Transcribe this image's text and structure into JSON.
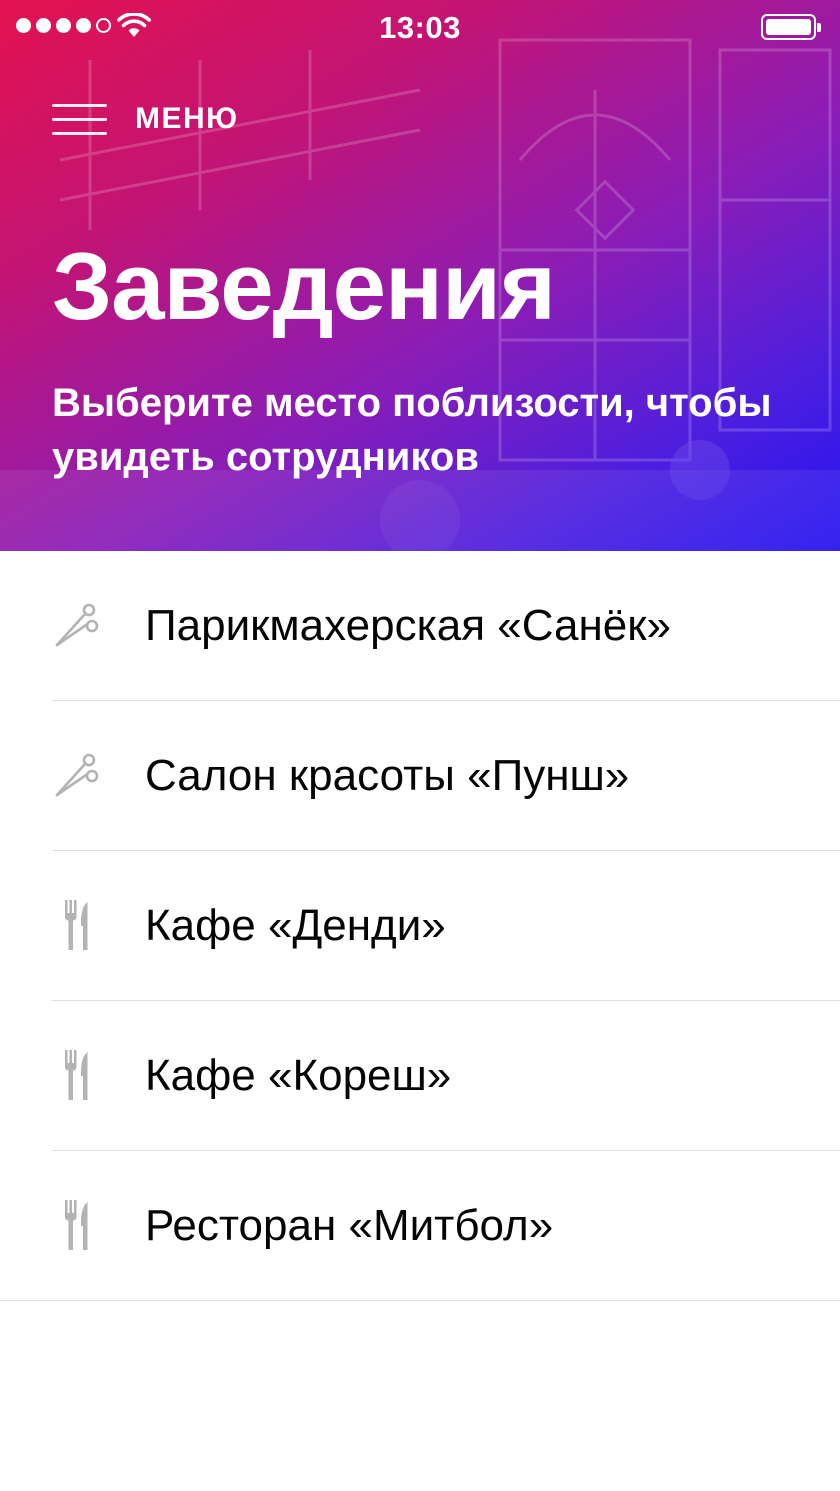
{
  "status_bar": {
    "time": "13:03",
    "signal_dots_filled": 4,
    "signal_dots_total": 5,
    "battery_level": 1.0,
    "icons": [
      "signal-dots-icon",
      "wifi-icon",
      "battery-icon"
    ]
  },
  "header": {
    "menu_label": "МЕНЮ",
    "title": "Заведения",
    "subtitle": "Выберите место поблизости, чтобы увидеть сотрудников",
    "gradient_colors": [
      "#e3124f",
      "#c21475",
      "#8a1db7",
      "#4a1ee0",
      "#2412ef"
    ]
  },
  "venues": [
    {
      "label": "Парикмахерская «Санёк»",
      "icon": "scissors-icon"
    },
    {
      "label": "Салон красоты «Пунш»",
      "icon": "scissors-icon"
    },
    {
      "label": "Кафе «Денди»",
      "icon": "fork-knife-icon"
    },
    {
      "label": "Кафе «Кореш»",
      "icon": "fork-knife-icon"
    },
    {
      "label": "Ресторан «Митбол»",
      "icon": "fork-knife-icon"
    }
  ],
  "colors": {
    "list_text": "#050505",
    "icon_gray": "#b3b3b3",
    "separator": "#dedede"
  }
}
